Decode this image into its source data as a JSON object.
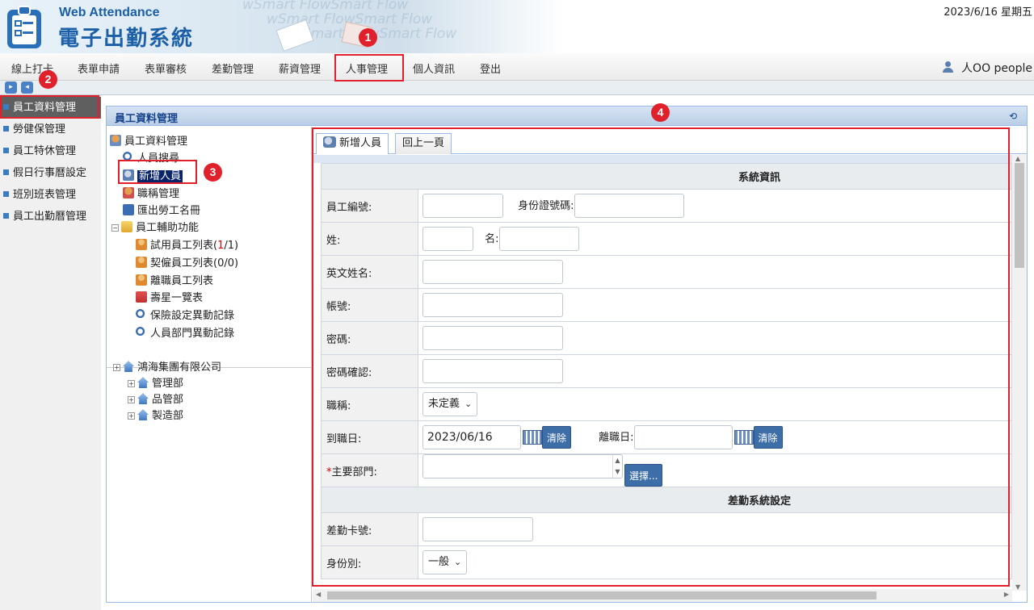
{
  "header": {
    "app_subtitle": "Web Attendance",
    "app_title": "電子出勤系統",
    "date_text": "2023/6/16 星期五",
    "banner_ghost": "wSmart FlowSmart Flow"
  },
  "menu": {
    "items": [
      "線上打卡",
      "表單申請",
      "表單審核",
      "差勤管理",
      "薪資管理",
      "人事管理",
      "個人資訊",
      "登出"
    ],
    "user": "人OO people"
  },
  "sidebar": {
    "items": [
      "員工資料管理",
      "勞健保管理",
      "員工特休管理",
      "假日行事曆設定",
      "班別班表管理",
      "員工出勤曆管理"
    ]
  },
  "panel": {
    "title": "員工資料管理",
    "tree": {
      "root": "員工資料管理",
      "search": "人員搜尋",
      "add": "新增人員",
      "roles": "職稱管理",
      "export": "匯出勞工名冊",
      "aux": "員工輔助功能",
      "trial_prefix": "試用員工列表(",
      "trial_count": "1",
      "trial_suffix": "/1)",
      "contract": "契僱員工列表(0/0)",
      "resigned": "離職員工列表",
      "birthday": "壽星一覽表",
      "insurance_log": "保險設定異動記錄",
      "dept_log": "人員部門異動記錄",
      "company": "鴻海集團有限公司",
      "depts": [
        "管理部",
        "品管部",
        "製造部"
      ]
    }
  },
  "tabs": {
    "new": "新增人員",
    "back": "回上一頁"
  },
  "form": {
    "section_system": "系統資訊",
    "emp_no_label": "員工編號:",
    "id_no_label": "身份證號碼:",
    "last_name_label": "姓:",
    "first_name_label": "名:",
    "en_name_label": "英文姓名:",
    "account_label": "帳號:",
    "password_label": "密碼:",
    "password_confirm_label": "密碼確認:",
    "title_label": "職稱:",
    "title_value": "未定義",
    "hire_label": "到職日:",
    "hire_value": "2023/06/16",
    "clear_label": "清除",
    "leave_label": "離職日:",
    "dept_required_mark": "*",
    "dept_label": "主要部門:",
    "choose_label": "選擇...",
    "section_attendance": "差勤系統設定",
    "card_label": "差勤卡號:",
    "identity_label": "身份別:",
    "identity_value": "一般"
  },
  "markers": [
    "1",
    "2",
    "3",
    "4"
  ]
}
